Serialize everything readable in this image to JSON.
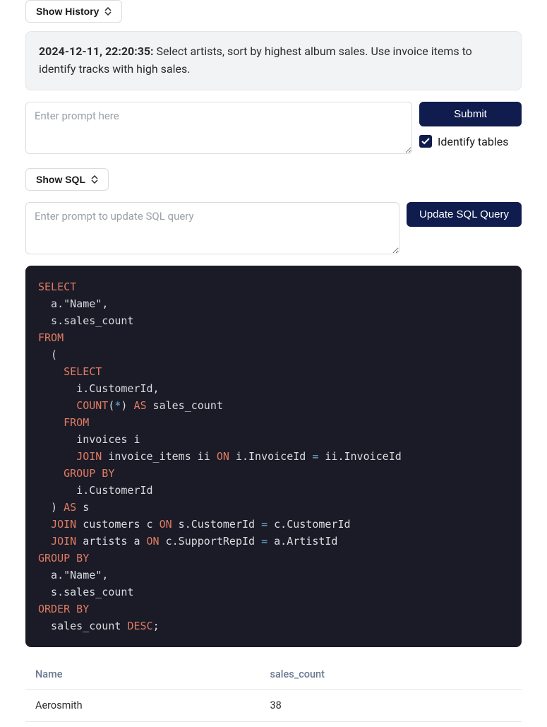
{
  "buttons": {
    "show_history": "Show History",
    "submit": "Submit",
    "show_sql": "Show SQL",
    "update_sql": "Update SQL Query"
  },
  "history": {
    "timestamp": "2024-12-11, 22:20:35:",
    "text": "Select artists, sort by highest album sales. Use invoice items to identify tracks with high sales."
  },
  "inputs": {
    "prompt_placeholder": "Enter prompt here",
    "update_placeholder": "Enter prompt to update SQL query"
  },
  "checkbox": {
    "identify_tables_label": "Identify tables",
    "checked": true
  },
  "sql": {
    "tokens": "SELECT|a.\"Name\",|s.sales_count|FROM|(|SELECT|i.CustomerId,|COUNT(*) AS sales_count|FROM|invoices i|JOIN invoice_items ii ON i.InvoiceId = ii.InvoiceId|GROUP BY|i.CustomerId|) AS s|JOIN customers c ON s.CustomerId = c.CustomerId|JOIN artists a ON c.SupportRepId = a.ArtistId|GROUP BY|a.\"Name\",|s.sales_count|ORDER BY|sales_count DESC;"
  },
  "results": {
    "columns": [
      "Name",
      "sales_count"
    ],
    "rows": [
      {
        "Name": "Aerosmith",
        "sales_count": "38"
      }
    ]
  }
}
